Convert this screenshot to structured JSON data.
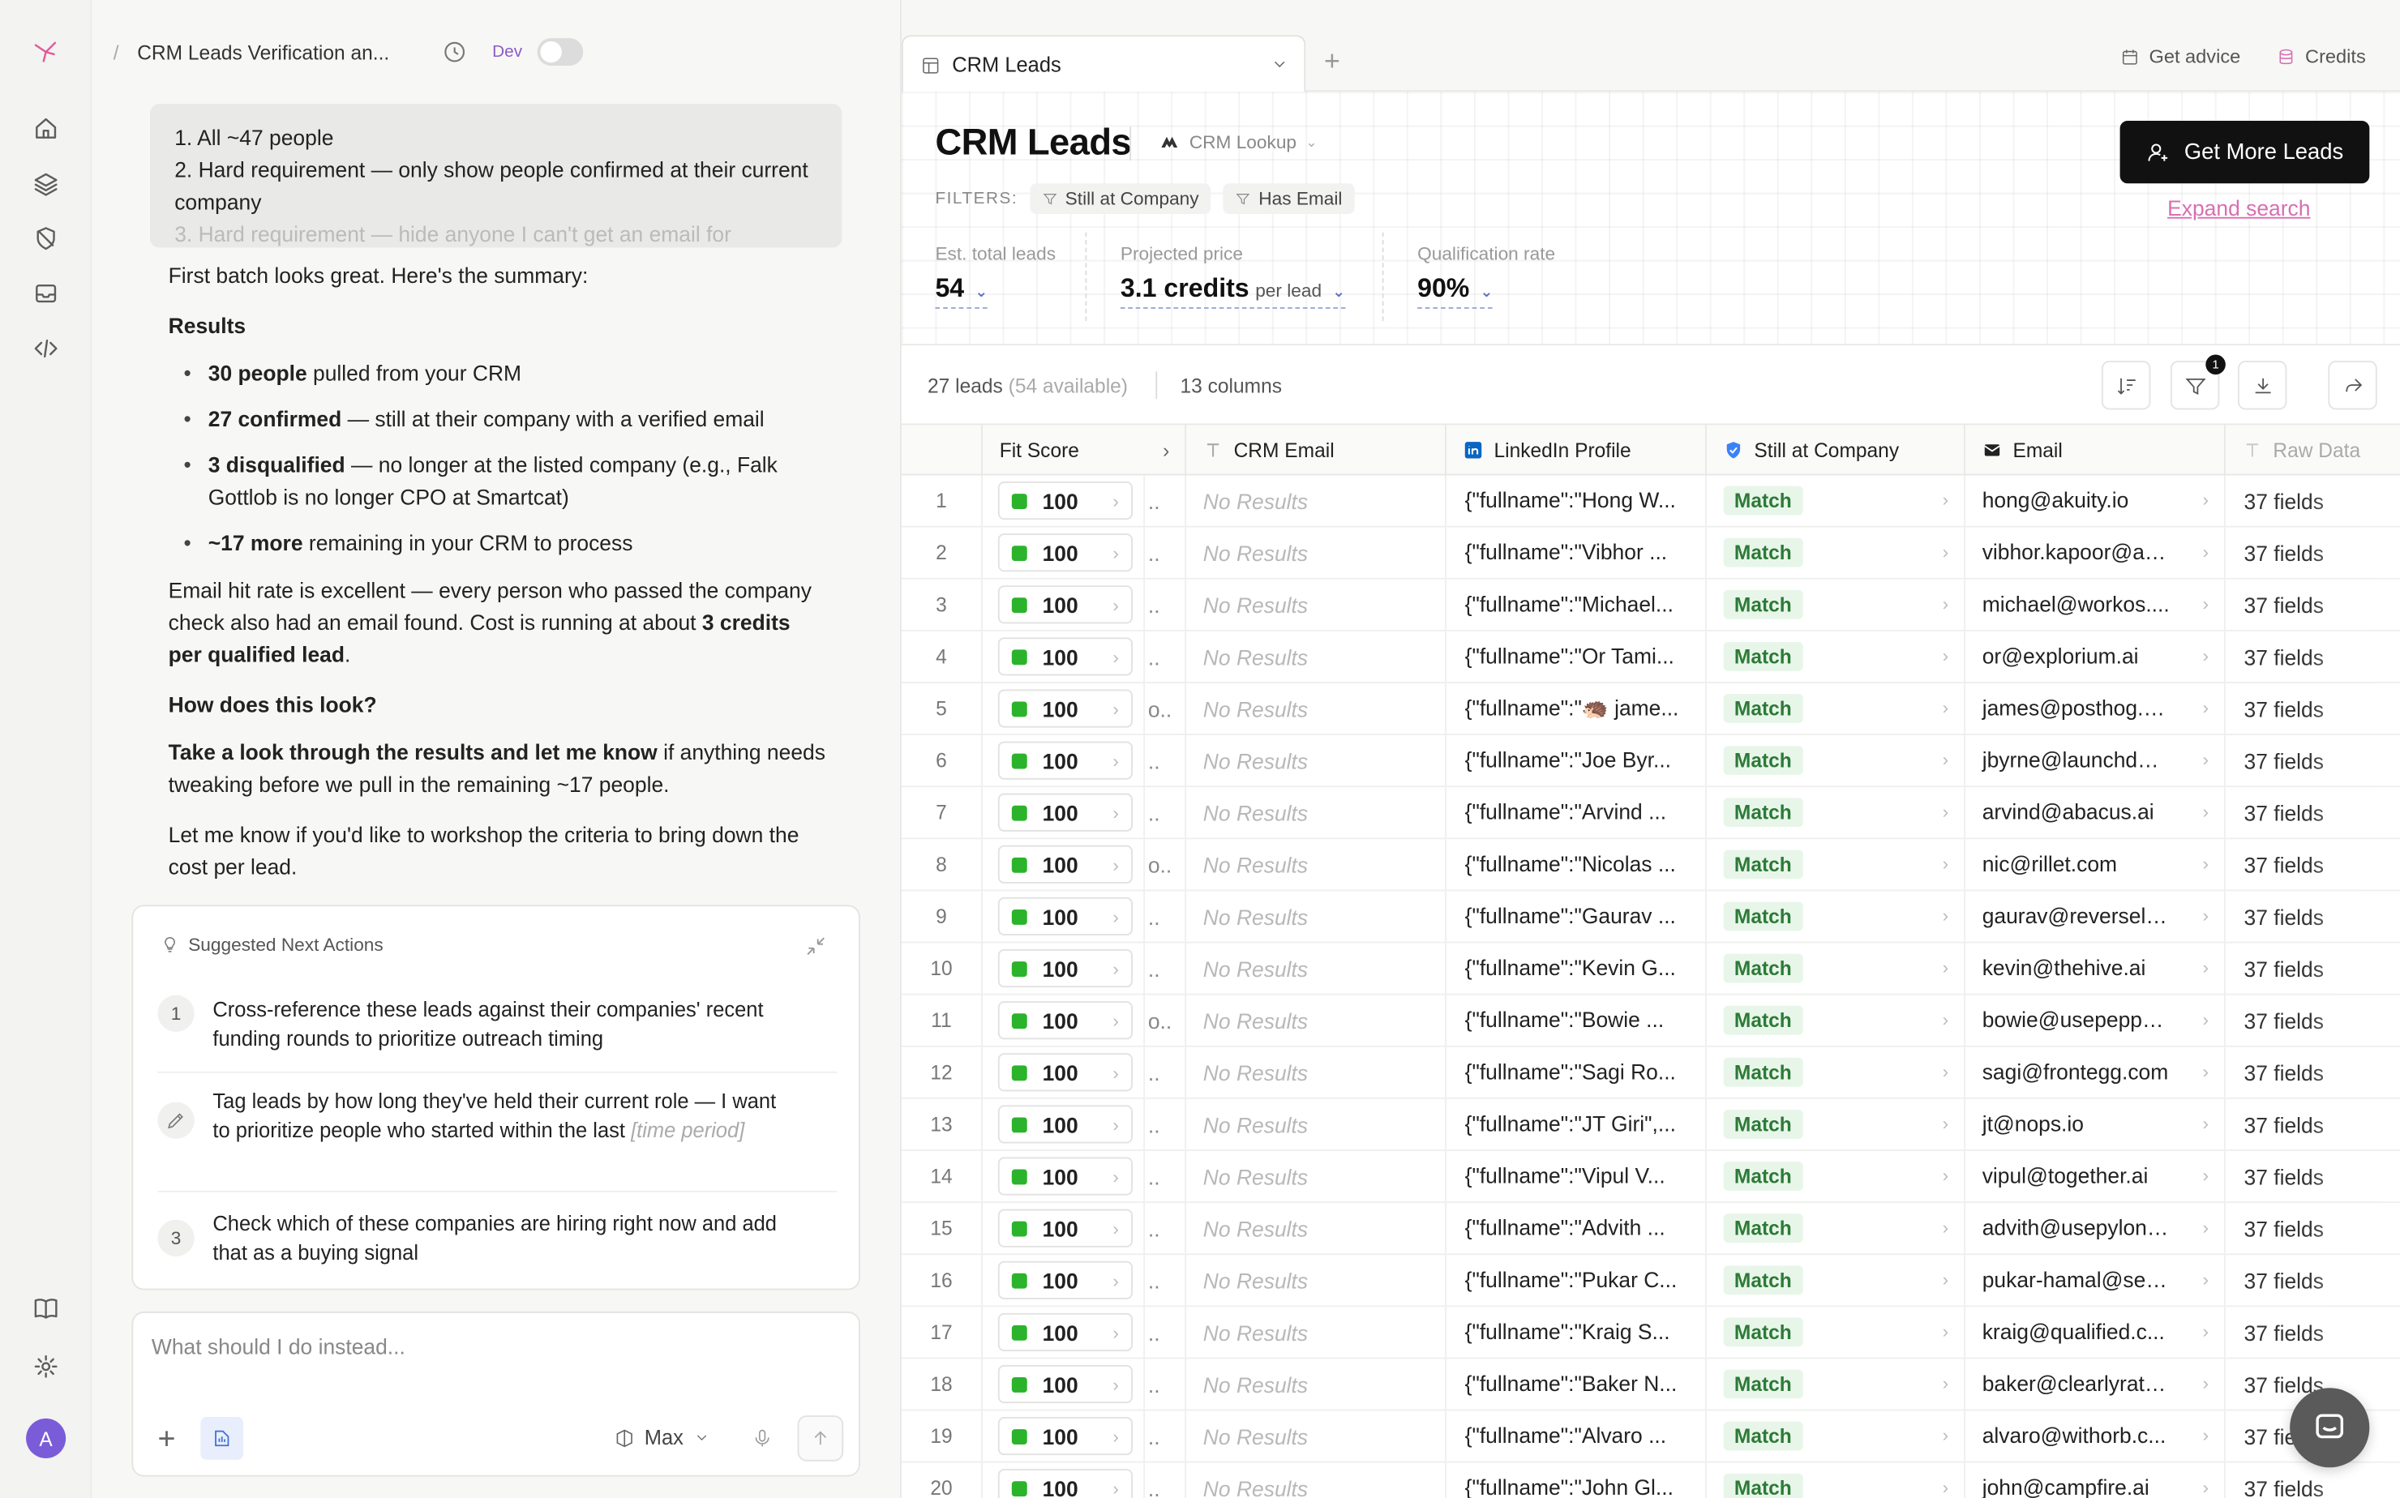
{
  "breadcrumb": {
    "title": "CRM Leads Verification an...",
    "dev_label": "Dev"
  },
  "chat": {
    "quote_lines": [
      "1. All ~47 people",
      "2. Hard requirement — only show people confirmed at their current company",
      "3. Hard requirement — hide anyone I can't get an email for"
    ],
    "intro": "First batch looks great. Here's the summary:",
    "results_heading": "Results",
    "results": [
      {
        "bold": "30 people",
        "rest": " pulled from your CRM"
      },
      {
        "bold": "27 confirmed",
        "rest": " — still at their company with a verified email"
      },
      {
        "bold": "3 disqualified",
        "rest": " — no longer at the listed company (e.g., Falk Gottlob is no longer CPO at Smartcat)"
      },
      {
        "bold": "~17 more",
        "rest": " remaining in your CRM to process"
      }
    ],
    "hit_rate_text": "Email hit rate is excellent — every person who passed the company check also had an email found. Cost is running at about ",
    "hit_rate_bold": "3 credits per qualified lead",
    "hit_rate_end": ".",
    "question": "How does this look?",
    "look_bold": "Take a look through the results and let me know",
    "look_rest": " if anything needs tweaking before we pull in the remaining ~17 people.",
    "workshop": "Let me know if you'd like to workshop the criteria to bring down the cost per lead."
  },
  "suggestions": {
    "title": "Suggested Next Actions",
    "items": [
      {
        "num": "1",
        "text": "Cross-reference these leads against their companies' recent funding rounds to prioritize outreach timing"
      },
      {
        "num": "",
        "text": "Tag leads by how long they've held their current role — I want to prioritize people who started within the last ",
        "placeholder": "[time period]"
      },
      {
        "num": "3",
        "text": "Check which of these companies are hiring right now and add that as a buying signal"
      }
    ]
  },
  "composer": {
    "placeholder": "What should I do instead...",
    "model": "Max"
  },
  "tabs": {
    "active": "CRM Leads"
  },
  "top_actions": {
    "advice": "Get advice",
    "credits": "Credits"
  },
  "header": {
    "title": "CRM Leads",
    "lookup": "CRM Lookup",
    "filters_label": "FILTERS:",
    "filters": [
      "Still at Company",
      "Has Email"
    ],
    "get_more": "Get More Leads",
    "expand": "Expand search"
  },
  "stats": {
    "est_label": "Est. total leads",
    "est_value": "54",
    "price_label": "Projected price",
    "price_value": "3.1 credits",
    "price_unit": "per lead",
    "qual_label": "Qualification rate",
    "qual_value": "90%"
  },
  "toolbar": {
    "leads_count": "27 leads",
    "available": "(54 available)",
    "columns": "13 columns",
    "filter_badge": "1"
  },
  "table": {
    "headers": {
      "fit": "Fit Score",
      "crm_email": "CRM Email",
      "linkedin": "LinkedIn Profile",
      "still": "Still at Company",
      "email": "Email",
      "raw": "Raw Data"
    },
    "no_results": "No Results",
    "match_label": "Match",
    "raw_label": "37 fields",
    "rows": [
      {
        "n": "1",
        "fit": "100",
        "trunc": "..",
        "li": "{\"fullname\":\"Hong W...",
        "email": "hong@akuity.io"
      },
      {
        "n": "2",
        "fit": "100",
        "trunc": "..",
        "li": "{\"fullname\":\"Vibhor ...",
        "email": "vibhor.kapoor@ad..."
      },
      {
        "n": "3",
        "fit": "100",
        "trunc": "..",
        "li": "{\"fullname\":\"Michael...",
        "email": "michael@workos...."
      },
      {
        "n": "4",
        "fit": "100",
        "trunc": "..",
        "li": "{\"fullname\":\"Or Tami...",
        "email": "or@explorium.ai"
      },
      {
        "n": "5",
        "fit": "100",
        "trunc": "o..",
        "li": "{\"fullname\":\"🦔 jame...",
        "email": "james@posthog.c..."
      },
      {
        "n": "6",
        "fit": "100",
        "trunc": "..",
        "li": "{\"fullname\":\"Joe Byr...",
        "email": "jbyrne@launchdar..."
      },
      {
        "n": "7",
        "fit": "100",
        "trunc": "..",
        "li": "{\"fullname\":\"Arvind ...",
        "email": "arvind@abacus.ai"
      },
      {
        "n": "8",
        "fit": "100",
        "trunc": "o..",
        "li": "{\"fullname\":\"Nicolas ...",
        "email": "nic@rillet.com"
      },
      {
        "n": "9",
        "fit": "100",
        "trunc": "..",
        "li": "{\"fullname\":\"Gaurav ...",
        "email": "gaurav@reverselo..."
      },
      {
        "n": "10",
        "fit": "100",
        "trunc": "..",
        "li": "{\"fullname\":\"Kevin G...",
        "email": "kevin@thehive.ai"
      },
      {
        "n": "11",
        "fit": "100",
        "trunc": "o..",
        "li": "{\"fullname\":\"Bowie ...",
        "email": "bowie@usepepper..."
      },
      {
        "n": "12",
        "fit": "100",
        "trunc": "..",
        "li": "{\"fullname\":\"Sagi Ro...",
        "email": "sagi@frontegg.com"
      },
      {
        "n": "13",
        "fit": "100",
        "trunc": "..",
        "li": "{\"fullname\":\"JT Giri\",...",
        "email": "jt@nops.io"
      },
      {
        "n": "14",
        "fit": "100",
        "trunc": "..",
        "li": "{\"fullname\":\"Vipul V...",
        "email": "vipul@together.ai"
      },
      {
        "n": "15",
        "fit": "100",
        "trunc": "..",
        "li": "{\"fullname\":\"Advith ...",
        "email": "advith@usepylon...."
      },
      {
        "n": "16",
        "fit": "100",
        "trunc": "..",
        "li": "{\"fullname\":\"Pukar C...",
        "email": "pukar-hamal@sec..."
      },
      {
        "n": "17",
        "fit": "100",
        "trunc": "..",
        "li": "{\"fullname\":\"Kraig S...",
        "email": "kraig@qualified.c..."
      },
      {
        "n": "18",
        "fit": "100",
        "trunc": "..",
        "li": "{\"fullname\":\"Baker N...",
        "email": "baker@clearlyrate..."
      },
      {
        "n": "19",
        "fit": "100",
        "trunc": "..",
        "li": "{\"fullname\":\"Alvaro ...",
        "email": "alvaro@withorb.c..."
      },
      {
        "n": "20",
        "fit": "100",
        "trunc": "..",
        "li": "{\"fullname\":\"John Gl...",
        "email": "john@campfire.ai"
      }
    ]
  },
  "colors": {
    "accent_pink": "#d86fb1",
    "match_green": "#2c7a36",
    "fit_green": "#2bb32b",
    "avatar": "#7a5cd9"
  },
  "icons": [
    "logo-icon",
    "home-icon",
    "layers-icon",
    "shield-off-icon",
    "inbox-icon",
    "code-icon",
    "book-icon",
    "settings-icon"
  ],
  "avatar_letter": "A"
}
